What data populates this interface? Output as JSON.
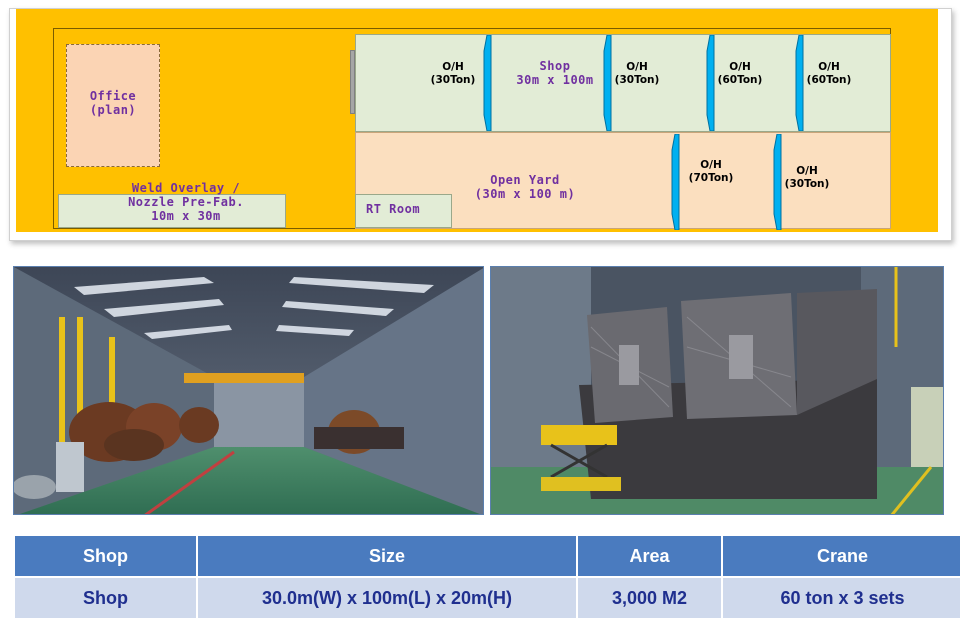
{
  "plan": {
    "office": [
      "Office",
      "(plan)"
    ],
    "weld": [
      "Weld Overlay /",
      "Nozzle Pre-Fab.",
      "10m x 30m"
    ],
    "shop": [
      "Shop",
      "30m x 100m"
    ],
    "yard": [
      "Open Yard",
      "(30m x 100 m)"
    ],
    "rt_room": "RT Room",
    "cranes_shop": [
      {
        "top": "O/H",
        "cap": "(30Ton)"
      },
      {
        "top": "O/H",
        "cap": "(30Ton)"
      },
      {
        "top": "O/H",
        "cap": "(60Ton)"
      },
      {
        "top": "O/H",
        "cap": "(60Ton)"
      }
    ],
    "cranes_yard": [
      {
        "top": "O/H",
        "cap": "(70Ton)"
      },
      {
        "top": "O/H",
        "cap": "(30Ton)"
      }
    ],
    "colors": {
      "yellow": "#ffc000",
      "shop": "#e2ecd6",
      "yard": "#fbdfbf",
      "crane": "#00b0f0",
      "text": "#7030a0"
    }
  },
  "photos": {
    "left": {
      "subject": "shop-interior-with-overhead-crane-and-vessels"
    },
    "right": {
      "subject": "large-fabricated-box-structure-with-scissor-lift"
    }
  },
  "table": {
    "headers": [
      "Shop",
      "Size",
      "Area",
      "Crane"
    ],
    "row": [
      "Shop",
      "30.0m(W) x 100m(L) x 20m(H)",
      "3,000 M2",
      "60 ton x 3 sets"
    ],
    "colors": {
      "header_bg": "#4a7bbf",
      "cell_bg": "#cfd9ec",
      "cell_text": "#1f2f8f"
    }
  }
}
